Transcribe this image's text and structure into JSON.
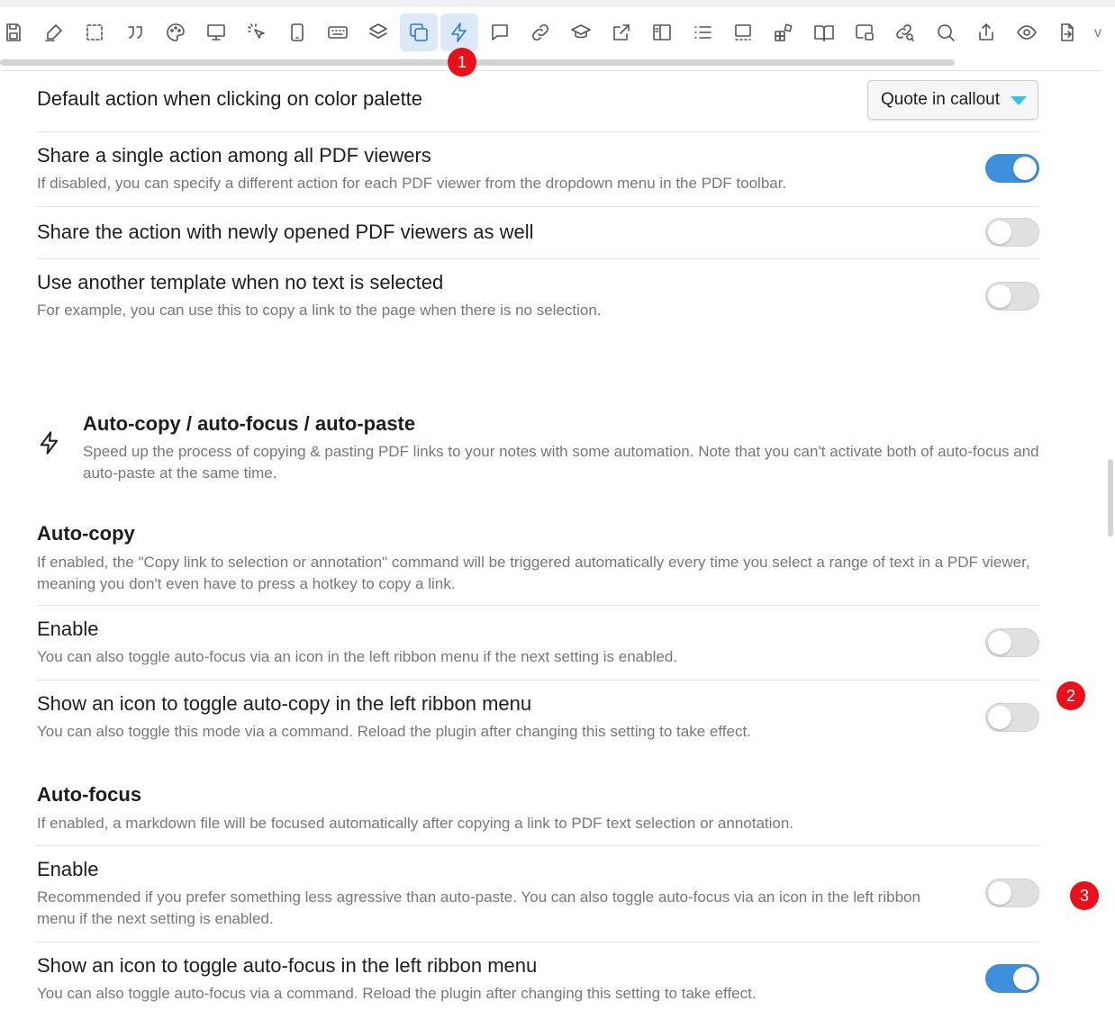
{
  "toolbar": {
    "icons": [
      "save-icon",
      "highlighter-icon",
      "selection-box-icon",
      "quote-icon",
      "palette-icon",
      "monitor-icon",
      "pointer-click-icon",
      "tablet-icon",
      "keyboard-icon",
      "layers-icon",
      "copy-icon",
      "lightning-icon",
      "comment-icon",
      "link-icon",
      "graduation-cap-icon",
      "external-link-icon",
      "sidebar-panel-icon",
      "list-icon",
      "presentation-icon",
      "widgets-icon",
      "book-open-icon",
      "picture-in-picture-icon",
      "link-search-icon",
      "search-icon",
      "share-upload-icon",
      "eye-icon",
      "file-export-icon"
    ],
    "more": "v"
  },
  "badges": [
    "1",
    "2",
    "3"
  ],
  "settings": {
    "color_palette": {
      "name": "Default action when clicking on color palette",
      "value": "Quote in callout"
    },
    "share_single": {
      "name": "Share a single action among all PDF viewers",
      "desc": "If disabled, you can specify a different action for each PDF viewer from the dropdown menu in the PDF toolbar.",
      "on": true
    },
    "share_new": {
      "name": "Share the action with newly opened PDF viewers as well",
      "on": false
    },
    "another_template": {
      "name": "Use another template when no text is selected",
      "desc": "For example, you can use this to copy a link to the page when there is no selection.",
      "on": false
    }
  },
  "section": {
    "icon": "lightning-icon",
    "title": "Auto-copy / auto-focus / auto-paste",
    "desc": "Speed up the process of copying & pasting PDF links to your notes with some automation. Note that you can't activate both of auto-focus and auto-paste at the same time."
  },
  "autocopy": {
    "title": "Auto-copy",
    "desc": "If enabled, the \"Copy link to selection or annotation\" command will be triggered automatically every time you select a range of text in a PDF viewer, meaning you don't even have to press a hotkey to copy a link.",
    "enable_name": "Enable",
    "enable_desc": "You can also toggle auto-focus via an icon in the left ribbon menu if the next setting is enabled.",
    "enable_on": false,
    "icon_name": "Show an icon to toggle auto-copy in the left ribbon menu",
    "icon_desc": "You can also toggle this mode via a command. Reload the plugin after changing this setting to take effect.",
    "icon_on": false
  },
  "autofocus": {
    "title": "Auto-focus",
    "desc": "If enabled, a markdown file will be focused automatically after copying a link to PDF text selection or annotation.",
    "enable_name": "Enable",
    "enable_desc": "Recommended if you prefer something less agressive than auto-paste. You can also toggle auto-focus via an icon in the left ribbon menu if the next setting is enabled.",
    "enable_on": false,
    "icon_name": "Show an icon to toggle auto-focus in the left ribbon menu",
    "icon_desc": "You can also toggle auto-focus via a command. Reload the plugin after changing this setting to take effect.",
    "icon_on": true
  },
  "colors": {
    "accent": "#3e8fdc",
    "badge": "#e8101a",
    "active_tab_bg": "#dbe9f8",
    "caret": "#2fc6e8"
  }
}
